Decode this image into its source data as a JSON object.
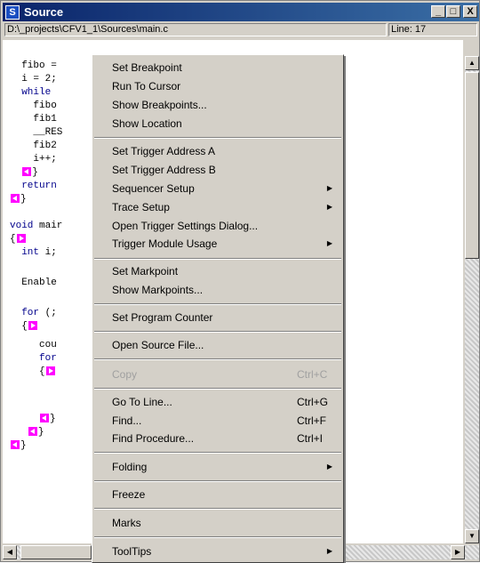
{
  "window": {
    "title": "Source",
    "app_icon": "S",
    "minimize": "_",
    "maximize": "□",
    "close": "X"
  },
  "path_bar": {
    "file_path": "D:\\_projects\\CFV1_1\\Sources\\main.c",
    "line_indicator": "Line: 17"
  },
  "code": {
    "l1": "  fibo = ",
    "l2": "  i = 2;",
    "l3a": "  ",
    "l3b": "while",
    "l4": "    fibo",
    "l5": "    fib1",
    "l6": "    __RES",
    "l7": "    fib2",
    "l8": "    i++;",
    "l9": "  ",
    "l10a": "  ",
    "l10b": "return",
    "l11": "",
    "l13a": "",
    "l13b": "void",
    "l13c": " mair",
    "l14": "{",
    "l15a": "  ",
    "l15b": "int",
    "l15c": " i;",
    "l17": "  Enable",
    "l19a": "  ",
    "l19b": "for",
    "l19c": " (;",
    "l20": "  {",
    "l21": "     cou",
    "l22a": "     ",
    "l22b": "for",
    "l23": "     {",
    "l26": "     ",
    "l27": "   ",
    "l28": "}",
    "brace": "}"
  },
  "context_menu": {
    "items": [
      {
        "label": "Set Breakpoint"
      },
      {
        "label": "Run To Cursor"
      },
      {
        "label": "Show Breakpoints..."
      },
      {
        "label": "Show Location"
      },
      {
        "label": "Set Trigger Address A"
      },
      {
        "label": "Set Trigger Address B"
      },
      {
        "label": "Sequencer Setup"
      },
      {
        "label": "Trace Setup"
      },
      {
        "label": "Open Trigger Settings Dialog..."
      },
      {
        "label": "Trigger Module Usage"
      },
      {
        "label": "Set Markpoint"
      },
      {
        "label": "Show Markpoints..."
      },
      {
        "label": "Set Program Counter"
      },
      {
        "label": "Open Source File..."
      },
      {
        "label": "Copy",
        "shortcut": "Ctrl+C"
      },
      {
        "label": "Go To Line...",
        "shortcut": "Ctrl+G"
      },
      {
        "label": "Find...",
        "shortcut": "Ctrl+F"
      },
      {
        "label": "Find Procedure...",
        "shortcut": "Ctrl+I"
      },
      {
        "label": "Folding"
      },
      {
        "label": "Freeze"
      },
      {
        "label": "Marks"
      },
      {
        "label": "ToolTips"
      }
    ],
    "submenu_arrow": "▶"
  },
  "colors": {
    "title_bar": "#0a246a",
    "marker": "#ff00ff",
    "keyword": "#00008b"
  },
  "icons": {
    "scroll_up": "▲",
    "scroll_down": "▼",
    "scroll_left": "◀",
    "scroll_right": "▶"
  }
}
